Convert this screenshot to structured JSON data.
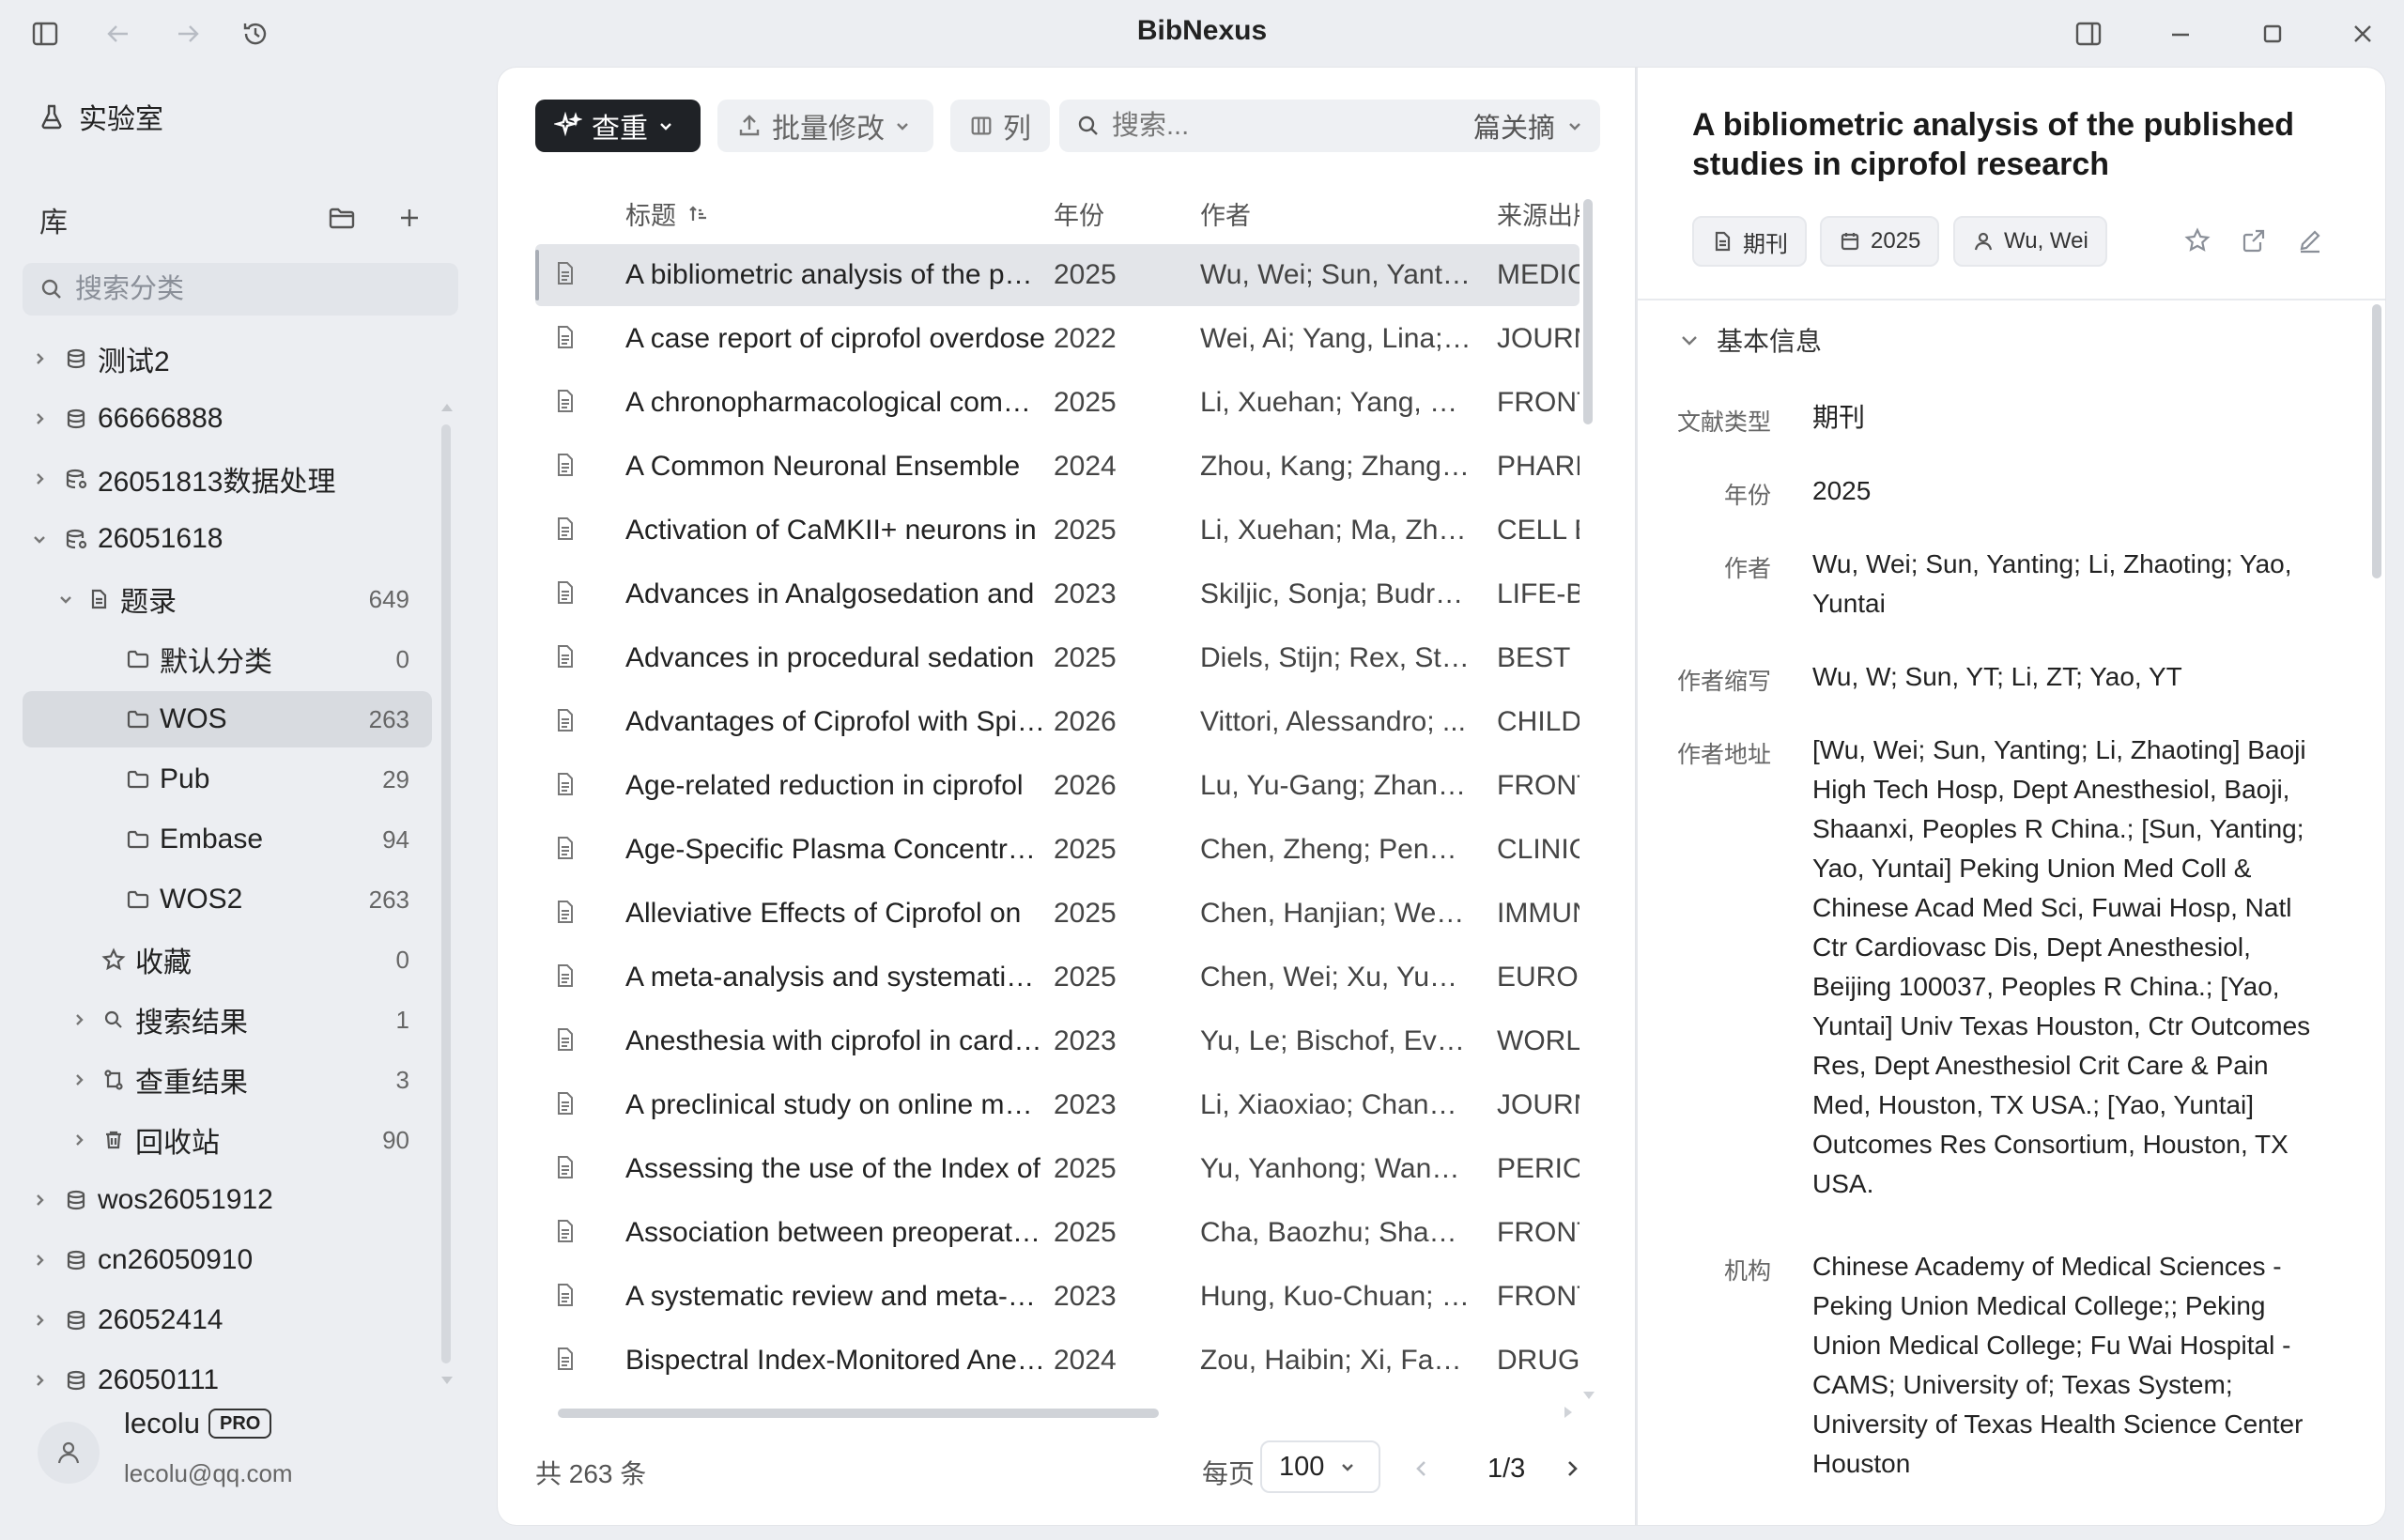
{
  "app": {
    "title": "BibNexus"
  },
  "sidebar": {
    "lab_label": "实验室",
    "library_title": "库",
    "search_placeholder": "搜索分类",
    "tree": [
      {
        "label": "测试2",
        "count": ""
      },
      {
        "label": "66666888",
        "count": ""
      },
      {
        "label": "26051813数据处理",
        "count": ""
      },
      {
        "label": "26051618",
        "count": ""
      },
      {
        "label": "题录",
        "count": "649"
      },
      {
        "label": "默认分类",
        "count": "0"
      },
      {
        "label": "WOS",
        "count": "263"
      },
      {
        "label": "Pub",
        "count": "29"
      },
      {
        "label": "Embase",
        "count": "94"
      },
      {
        "label": "WOS2",
        "count": "263"
      },
      {
        "label": "收藏",
        "count": "0"
      },
      {
        "label": "搜索结果",
        "count": "1"
      },
      {
        "label": "查重结果",
        "count": "3"
      },
      {
        "label": "回收站",
        "count": "90"
      },
      {
        "label": "wos26051912",
        "count": ""
      },
      {
        "label": "cn26050910",
        "count": ""
      },
      {
        "label": "26052414",
        "count": ""
      },
      {
        "label": "26050111",
        "count": ""
      }
    ],
    "user": {
      "name": "lecolu",
      "badge": "PRO",
      "email": "lecolu@qq.com"
    }
  },
  "toolbar": {
    "dedupe_label": "查重",
    "batch_label": "批量修改",
    "columns_label": "列",
    "search_placeholder": "搜索...",
    "search_scope": "篇关摘"
  },
  "table": {
    "headers": {
      "title": "标题",
      "year": "年份",
      "author": "作者",
      "source": "来源出版"
    },
    "rows": [
      {
        "title": "A bibliometric analysis of the published studies in ciprofol research",
        "year": "2025",
        "author": "Wu, Wei; Sun, Yanting; Li, Zhaoting; Yao, Yuntai",
        "source": "MEDICINE"
      },
      {
        "title": "A case report of ciprofol overdose",
        "year": "2022",
        "author": "Wei, Ai; Yang, Lina; ...",
        "source": "JOURNAL"
      },
      {
        "title": "A chronopharmacological comparison",
        "year": "2025",
        "author": "Li, Xuehan; Yang, Xin...",
        "source": "FRONTIERS"
      },
      {
        "title": "A Common Neuronal Ensemble",
        "year": "2024",
        "author": "Zhou, Kang; Zhang, ...",
        "source": "PHARMA"
      },
      {
        "title": "Activation of CaMKII+ neurons in",
        "year": "2025",
        "author": "Li, Xuehan; Ma, Zhixin",
        "source": "CELL B"
      },
      {
        "title": "Advances in Analgosedation and",
        "year": "2023",
        "author": "Skiljic, Sonja; Budrovic",
        "source": "LIFE-BASEL"
      },
      {
        "title": "Advances in procedural sedation",
        "year": "2025",
        "author": "Diels, Stijn; Rex, Steffen",
        "source": "BEST P"
      },
      {
        "title": "Advantages of Ciprofol with Spinal",
        "year": "2026",
        "author": "Vittori, Alessandro; ...",
        "source": "CHILDREN"
      },
      {
        "title": "Age-related reduction in ciprofol",
        "year": "2026",
        "author": "Lu, Yu-Gang; Zhang,...",
        "source": "FRONTIERS"
      },
      {
        "title": "Age-Specific Plasma Concentration",
        "year": "2025",
        "author": "Chen, Zheng; Peng, ...",
        "source": "CLINICAL"
      },
      {
        "title": "Alleviative Effects of Ciprofol on",
        "year": "2025",
        "author": "Chen, Hanjian; Wen, ...",
        "source": "IMMUNO"
      },
      {
        "title": "A meta-analysis and systematic review",
        "year": "2025",
        "author": "Chen, Wei; Xu, YuGuang",
        "source": "EUROPEAN"
      },
      {
        "title": "Anesthesia with ciprofol in cardiac",
        "year": "2023",
        "author": "Yu, Le; Bischof, Evelyn",
        "source": "WORLD"
      },
      {
        "title": "A preclinical study on online monitoring",
        "year": "2023",
        "author": "Li, Xiaoxiao; Chang, ...",
        "source": "JOURNAL"
      },
      {
        "title": "Assessing the use of the Index of",
        "year": "2025",
        "author": "Yu, Yanhong; Wang, ...",
        "source": "PERIOP"
      },
      {
        "title": "Association between preoperative",
        "year": "2025",
        "author": "Cha, Baozhu; Shao, ...",
        "source": "FRONTIERS"
      },
      {
        "title": "A systematic review and meta-analysis",
        "year": "2023",
        "author": "Hung, Kuo-Chuan; Chen",
        "source": "FRONTIERS"
      },
      {
        "title": "Bispectral Index-Monitored Anesthesia",
        "year": "2024",
        "author": "Zou, Haibin; Xi, Fang...",
        "source": "DRUG"
      }
    ]
  },
  "footer": {
    "total": "共 263 条",
    "per_page_label": "每页",
    "per_page_value": "100",
    "page": "1/3"
  },
  "detail": {
    "title": "A bibliometric analysis of the published studies in ciprofol research",
    "chips": {
      "type": "期刊",
      "year": "2025",
      "author": "Wu, Wei"
    },
    "section": "基本信息",
    "fields": {
      "type_label": "文献类型",
      "type_value": "期刊",
      "year_label": "年份",
      "year_value": "2025",
      "author_label": "作者",
      "author_value": "Wu, Wei; Sun, Yanting; Li, Zhaoting; Yao, Yuntai",
      "abbr_label": "作者缩写",
      "abbr_value": "Wu, W; Sun, YT; Li, ZT; Yao, YT",
      "address_label": "作者地址",
      "address_value": "[Wu, Wei; Sun, Yanting; Li, Zhaoting] Baoji High Tech Hosp, Dept Anesthesiol, Baoji, Shaanxi, Peoples R China.; [Sun, Yanting; Yao, Yuntai] Peking Union Med Coll & Chinese Acad Med Sci, Fuwai Hosp, Natl Ctr Cardiovasc Dis, Dept Anesthesiol, Beijing 100037, Peoples R China.; [Yao, Yuntai] Univ Texas Houston, Ctr Outcomes Res, Dept Anesthesiol Crit Care & Pain Med, Houston, TX USA.; [Yao, Yuntai] Outcomes Res Consortium, Houston, TX USA.",
      "org_label": "机构",
      "org_value": "Chinese Academy of Medical Sciences - Peking Union Medical College;; Peking Union Medical College; Fu Wai Hospital - CAMS; University of; Texas System; University of Texas Health Science Center Houston"
    }
  },
  "icons": {
    "sidebar_toggle": "sidebar-icon",
    "back": "arrow-left-icon",
    "forward": "arrow-right-icon",
    "history": "history-icon",
    "panel_toggle": "panel-right-icon",
    "minimize": "minimize-icon",
    "maximize": "maximize-icon",
    "close": "close-icon"
  }
}
